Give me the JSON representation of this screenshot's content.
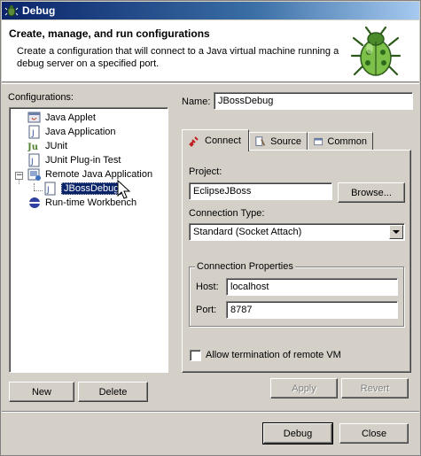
{
  "window": {
    "title": "Debug",
    "icon": "debug-bug-icon"
  },
  "banner": {
    "title": "Create, manage, and run configurations",
    "description": "Create a configuration that will connect to a Java virtual machine running a debug server on a specified port.",
    "image": "green-bug-icon"
  },
  "configurations": {
    "label": "Configurations:",
    "items": [
      {
        "label": "Java Applet",
        "icon": "java-applet-icon"
      },
      {
        "label": "Java Application",
        "icon": "java-application-icon"
      },
      {
        "label": "JUnit",
        "icon": "junit-icon"
      },
      {
        "label": "JUnit Plug-in Test",
        "icon": "junit-plugin-icon"
      },
      {
        "label": "Remote Java Application",
        "icon": "remote-java-icon",
        "expanded": true
      },
      {
        "label": "JBossDebug",
        "icon": "remote-config-icon",
        "selected": true
      },
      {
        "label": "Run-time Workbench",
        "icon": "workbench-icon"
      }
    ],
    "new_label": "New",
    "delete_label": "Delete"
  },
  "editor": {
    "name_label": "Name:",
    "name_value": "JBossDebug",
    "tabs": [
      {
        "label": "Connect",
        "icon": "connect-icon",
        "active": true
      },
      {
        "label": "Source",
        "icon": "source-icon"
      },
      {
        "label": "Common",
        "icon": "common-icon"
      }
    ],
    "project_label": "Project:",
    "project_value": "EclipseJBoss",
    "browse_label": "Browse...",
    "connection_type_label": "Connection Type:",
    "connection_type_value": "Standard (Socket Attach)",
    "connection_props_title": "Connection Properties",
    "host_label": "Host:",
    "host_value": "localhost",
    "port_label": "Port:",
    "port_value": "8787",
    "allow_termination_label": "Allow termination of remote VM",
    "allow_termination_checked": false,
    "apply_label": "Apply",
    "revert_label": "Revert"
  },
  "footer": {
    "debug_label": "Debug",
    "close_label": "Close"
  }
}
